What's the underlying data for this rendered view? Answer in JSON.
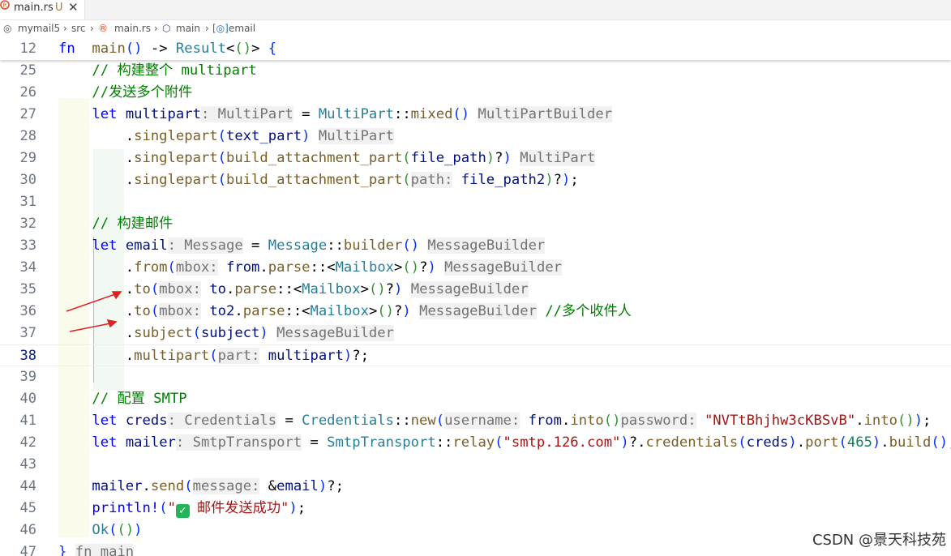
{
  "tab": {
    "filename": "main.rs",
    "status": "U",
    "close_glyph": "✕",
    "icon": "rust-icon"
  },
  "breadcrumb": {
    "items": [
      "mymail5",
      "src",
      "main.rs",
      "main",
      "email"
    ],
    "separator": "›"
  },
  "editor": {
    "current_line": 38,
    "sticky": {
      "number": "12",
      "parts": [
        [
          "kw",
          "fn"
        ],
        [
          "",
          "  "
        ],
        [
          "fn",
          "main"
        ],
        [
          "p1",
          "()"
        ],
        [
          "",
          ""
        ],
        [
          "",
          " -> "
        ],
        [
          "ty",
          "Result"
        ],
        [
          "",
          "<"
        ],
        [
          "p2",
          "()"
        ],
        [
          "",
          "> "
        ],
        [
          "p1",
          "{"
        ]
      ]
    },
    "lines": [
      {
        "number": "25",
        "parts": [
          [
            "",
            "    "
          ],
          [
            "cm",
            "// 构建整个 multipart"
          ]
        ]
      },
      {
        "number": "26",
        "parts": [
          [
            "",
            "    "
          ],
          [
            "cm",
            "//发送多个附件"
          ]
        ]
      },
      {
        "number": "27",
        "parts": [
          [
            "",
            "    "
          ],
          [
            "kw",
            "let"
          ],
          [
            "",
            " "
          ],
          [
            "var",
            "multipart"
          ],
          [
            "hint",
            ": MultiPart"
          ],
          [
            "",
            " = "
          ],
          [
            "ty",
            "MultiPart"
          ],
          [
            "",
            "::"
          ],
          [
            "fn",
            "mixed"
          ],
          [
            "p1",
            "()"
          ],
          [
            "",
            " "
          ],
          [
            "hint",
            "MultiPartBuilder"
          ]
        ]
      },
      {
        "number": "28",
        "parts": [
          [
            "",
            "        ."
          ],
          [
            "fn",
            "singlepart"
          ],
          [
            "p1",
            "("
          ],
          [
            "var",
            "text_part"
          ],
          [
            "p1",
            ")"
          ],
          [
            "",
            " "
          ],
          [
            "hint",
            "MultiPart"
          ]
        ]
      },
      {
        "number": "29",
        "parts": [
          [
            "",
            "        ."
          ],
          [
            "fn",
            "singlepart"
          ],
          [
            "p1",
            "("
          ],
          [
            "fn",
            "build_attachment_part"
          ],
          [
            "p2",
            "("
          ],
          [
            "var",
            "file_path"
          ],
          [
            "p2",
            ")"
          ],
          [
            "",
            "?"
          ],
          [
            "p1",
            ")"
          ],
          [
            "",
            " "
          ],
          [
            "hint",
            "MultiPart"
          ]
        ]
      },
      {
        "number": "30",
        "parts": [
          [
            "",
            "        ."
          ],
          [
            "fn",
            "singlepart"
          ],
          [
            "p1",
            "("
          ],
          [
            "fn",
            "build_attachment_part"
          ],
          [
            "p2",
            "("
          ],
          [
            "hint",
            "path:"
          ],
          [
            "",
            " "
          ],
          [
            "var",
            "file_path2"
          ],
          [
            "p2",
            ")"
          ],
          [
            "",
            "?"
          ],
          [
            "p1",
            ")"
          ],
          [
            "",
            ";"
          ]
        ]
      },
      {
        "number": "31",
        "parts": []
      },
      {
        "number": "32",
        "parts": [
          [
            "",
            "    "
          ],
          [
            "cm",
            "// 构建邮件"
          ]
        ]
      },
      {
        "number": "33",
        "parts": [
          [
            "",
            "    "
          ],
          [
            "kw",
            "let"
          ],
          [
            "",
            " "
          ],
          [
            "var",
            "email"
          ],
          [
            "hint",
            ": Message"
          ],
          [
            "",
            " = "
          ],
          [
            "ty",
            "Message"
          ],
          [
            "",
            "::"
          ],
          [
            "fn",
            "builder"
          ],
          [
            "p1",
            "()"
          ],
          [
            "",
            " "
          ],
          [
            "hint",
            "MessageBuilder"
          ]
        ]
      },
      {
        "number": "34",
        "parts": [
          [
            "",
            "        ."
          ],
          [
            "fn",
            "from"
          ],
          [
            "p1",
            "("
          ],
          [
            "hint",
            "mbox:"
          ],
          [
            "",
            " "
          ],
          [
            "var",
            "from"
          ],
          [
            "",
            "."
          ],
          [
            "fn",
            "parse"
          ],
          [
            "",
            "::<"
          ],
          [
            "ty",
            "Mailbox"
          ],
          [
            "",
            ">"
          ],
          [
            "p2",
            "()"
          ],
          [
            "",
            "?"
          ],
          [
            "p1",
            ")"
          ],
          [
            "",
            " "
          ],
          [
            "hint",
            "MessageBuilder"
          ]
        ]
      },
      {
        "number": "35",
        "parts": [
          [
            "",
            "        ."
          ],
          [
            "fn",
            "to"
          ],
          [
            "p1",
            "("
          ],
          [
            "hint",
            "mbox:"
          ],
          [
            "",
            " "
          ],
          [
            "var",
            "to"
          ],
          [
            "",
            "."
          ],
          [
            "fn",
            "parse"
          ],
          [
            "",
            "::<"
          ],
          [
            "ty",
            "Mailbox"
          ],
          [
            "",
            ">"
          ],
          [
            "p2",
            "()"
          ],
          [
            "",
            "?"
          ],
          [
            "p1",
            ")"
          ],
          [
            "",
            " "
          ],
          [
            "hint",
            "MessageBuilder"
          ]
        ]
      },
      {
        "number": "36",
        "parts": [
          [
            "",
            "        ."
          ],
          [
            "fn",
            "to"
          ],
          [
            "p1",
            "("
          ],
          [
            "hint",
            "mbox:"
          ],
          [
            "",
            " "
          ],
          [
            "var",
            "to2"
          ],
          [
            "",
            "."
          ],
          [
            "fn",
            "parse"
          ],
          [
            "",
            "::<"
          ],
          [
            "ty",
            "Mailbox"
          ],
          [
            "",
            ">"
          ],
          [
            "p2",
            "()"
          ],
          [
            "",
            "?"
          ],
          [
            "p1",
            ")"
          ],
          [
            "",
            " "
          ],
          [
            "hint",
            "MessageBuilder"
          ],
          [
            "",
            " "
          ],
          [
            "cm",
            "//多个收件人"
          ]
        ]
      },
      {
        "number": "37",
        "parts": [
          [
            "",
            "        ."
          ],
          [
            "fn",
            "subject"
          ],
          [
            "p1",
            "("
          ],
          [
            "var",
            "subject"
          ],
          [
            "p1",
            ")"
          ],
          [
            "",
            " "
          ],
          [
            "hint",
            "MessageBuilder"
          ]
        ]
      },
      {
        "number": "38",
        "parts": [
          [
            "",
            "        ."
          ],
          [
            "fn",
            "multipart"
          ],
          [
            "p1",
            "("
          ],
          [
            "hint",
            "part:"
          ],
          [
            "",
            " "
          ],
          [
            "var",
            "multipart"
          ],
          [
            "p1",
            ")"
          ],
          [
            "",
            "?;"
          ]
        ]
      },
      {
        "number": "39",
        "parts": []
      },
      {
        "number": "40",
        "parts": [
          [
            "",
            "    "
          ],
          [
            "cm",
            "// 配置 SMTP"
          ]
        ]
      },
      {
        "number": "41",
        "parts": [
          [
            "",
            "    "
          ],
          [
            "kw",
            "let"
          ],
          [
            "",
            " "
          ],
          [
            "var",
            "creds"
          ],
          [
            "hint",
            ": Credentials"
          ],
          [
            "",
            " = "
          ],
          [
            "ty",
            "Credentials"
          ],
          [
            "",
            "::"
          ],
          [
            "fn",
            "new"
          ],
          [
            "p1",
            "("
          ],
          [
            "hint",
            "username:"
          ],
          [
            "",
            " "
          ],
          [
            "var",
            "from"
          ],
          [
            "",
            "."
          ],
          [
            "fn",
            "into"
          ],
          [
            "p2",
            "()"
          ],
          [
            ", ",
            ""
          ],
          [
            "hint",
            "password:"
          ],
          [
            "",
            " "
          ],
          [
            "str",
            "\"NVTtBhjhw3cKBSvB\""
          ],
          [
            "",
            "."
          ],
          [
            "fn",
            "into"
          ],
          [
            "p2",
            "()"
          ],
          [
            "p1",
            ")"
          ],
          [
            "",
            ";"
          ]
        ]
      },
      {
        "number": "42",
        "parts": [
          [
            "",
            "    "
          ],
          [
            "kw",
            "let"
          ],
          [
            "",
            " "
          ],
          [
            "var",
            "mailer"
          ],
          [
            "hint",
            ": SmtpTransport"
          ],
          [
            "",
            " = "
          ],
          [
            "ty",
            "SmtpTransport"
          ],
          [
            "",
            "::"
          ],
          [
            "fn",
            "relay"
          ],
          [
            "p1",
            "("
          ],
          [
            "str",
            "\"smtp.126.com\""
          ],
          [
            "p1",
            ")"
          ],
          [
            "",
            "?."
          ],
          [
            "fn",
            "credentials"
          ],
          [
            "p1",
            "("
          ],
          [
            "var",
            "creds"
          ],
          [
            "p1",
            ")"
          ],
          [
            "",
            "."
          ],
          [
            "fn",
            "port"
          ],
          [
            "p1",
            "("
          ],
          [
            "num",
            "465"
          ],
          [
            "p1",
            ")"
          ],
          [
            "",
            "."
          ],
          [
            "fn",
            "build"
          ],
          [
            "p1",
            "()"
          ],
          [
            "",
            ";"
          ]
        ]
      },
      {
        "number": "43",
        "parts": []
      },
      {
        "number": "44",
        "parts": [
          [
            "",
            "    "
          ],
          [
            "var",
            "mailer"
          ],
          [
            "",
            "."
          ],
          [
            "fn",
            "send"
          ],
          [
            "p1",
            "("
          ],
          [
            "hint",
            "message:"
          ],
          [
            "",
            " &"
          ],
          [
            "var",
            "email"
          ],
          [
            "p1",
            ")"
          ],
          [
            "",
            "?;"
          ]
        ]
      },
      {
        "number": "45",
        "parts": [
          [
            "",
            "    "
          ],
          [
            "mac",
            "println!"
          ],
          [
            "p1",
            "("
          ],
          [
            "str",
            "\""
          ],
          [
            "check",
            "✓"
          ],
          [
            "str",
            "邮件发送成功\""
          ],
          [
            "p1",
            ")"
          ],
          [
            "",
            ";"
          ]
        ]
      },
      {
        "number": "46",
        "parts": [
          [
            "",
            "    "
          ],
          [
            "ty",
            "Ok"
          ],
          [
            "p1",
            "("
          ],
          [
            "p2",
            "()"
          ],
          [
            "p1",
            ")"
          ]
        ]
      },
      {
        "number": "47",
        "parts": [
          [
            "p1",
            "}"
          ],
          [
            "",
            " "
          ],
          [
            "hint",
            "fn main"
          ]
        ]
      }
    ]
  },
  "colors": {
    "accent": "#0000ff",
    "annotation_arrow": "#e02020",
    "rust_logo": "#e04e1f"
  },
  "watermark": "CSDN @景天科技苑"
}
